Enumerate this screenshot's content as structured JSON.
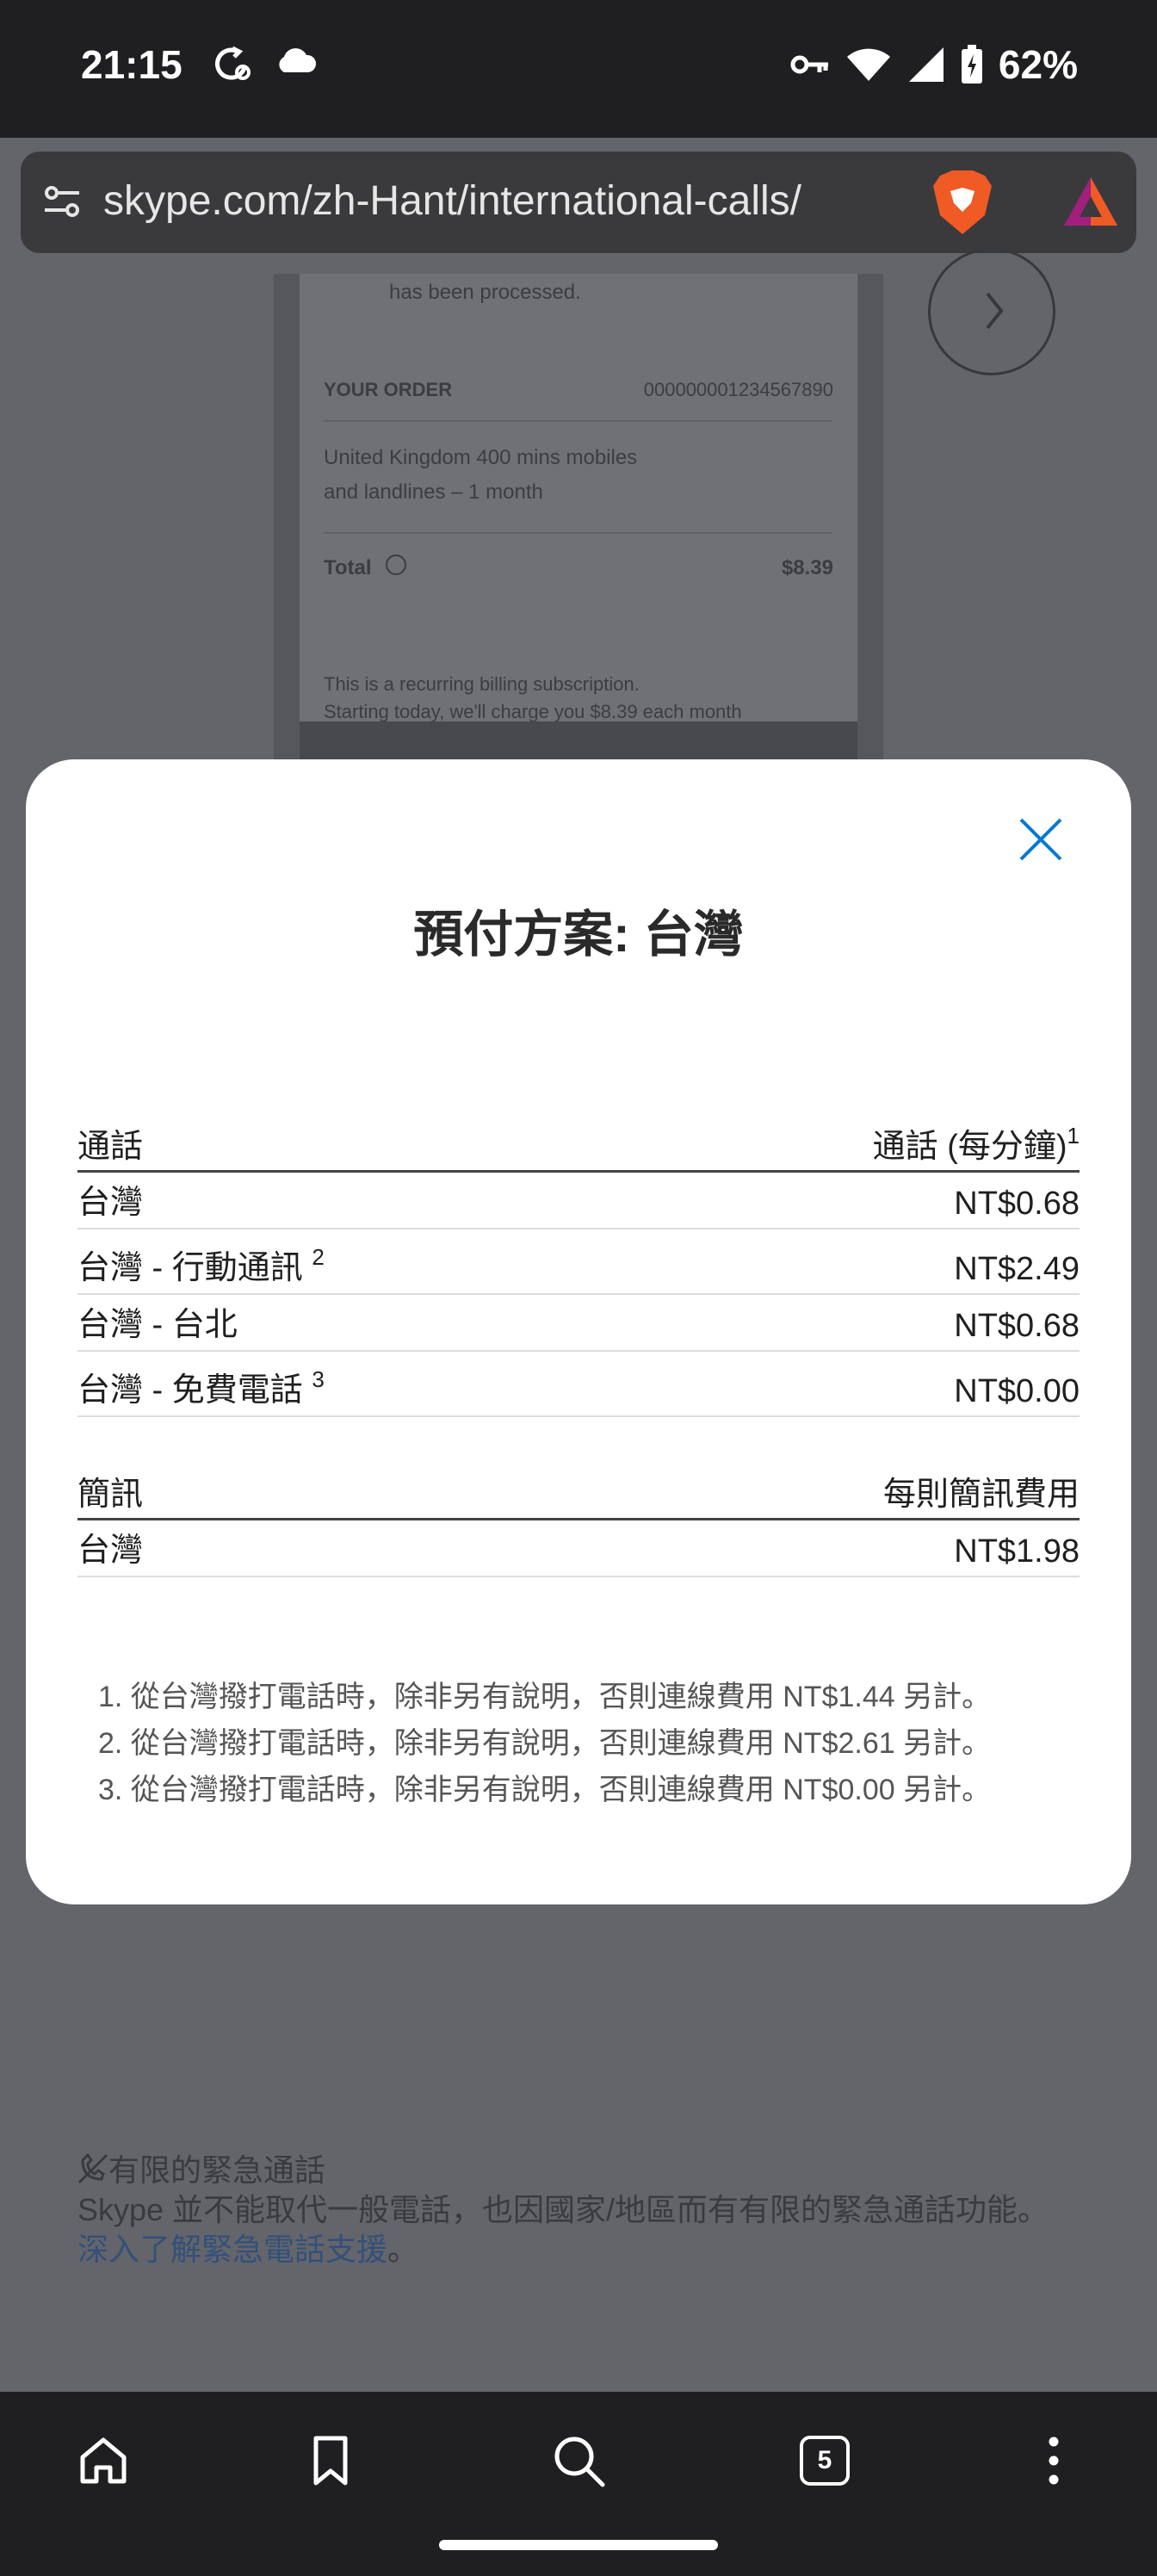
{
  "status_bar": {
    "time": "21:15",
    "battery": "62%",
    "icons": [
      "sync-icon",
      "cloud-icon",
      "vpn-key-icon",
      "wifi-icon",
      "signal-icon",
      "battery-charging-icon"
    ]
  },
  "browser": {
    "url": "skype.com/zh-Hant/international-calls/",
    "tab_count": "5",
    "toolbar_icons": [
      "home-icon",
      "bookmark-icon",
      "search-icon",
      "tabs-icon",
      "more-icon"
    ]
  },
  "background_page": {
    "processed_text": "has been processed.",
    "your_order_label": "YOUR ORDER",
    "order_number": "000000001234567890",
    "plan_line1": "United Kingdom 400 mins mobiles",
    "plan_line2": "and landlines – 1 month",
    "total_label": "Total",
    "total_value": "$8.39",
    "recurring_text": "This is a recurring billing subscription.",
    "charge_text": "Starting today, we'll charge you $8.39 each month",
    "emergency_title": "有限的緊急通話",
    "emergency_body": "Skype 並不能取代一般電話，也因國家/地區而有有限的緊急通話功能。",
    "emergency_link": "深入了解緊急電話支援",
    "emergency_link_suffix": "。"
  },
  "modal": {
    "title": "預付方案: 台灣",
    "calls_table": {
      "header_left": "通話",
      "header_right": "通話 (每分鐘)",
      "header_right_sup": "1",
      "rows": [
        {
          "name": "台灣",
          "sup": "",
          "rate": "NT$0.68"
        },
        {
          "name": "台灣 - 行動通訊 ",
          "sup": "2",
          "rate": "NT$2.49"
        },
        {
          "name": "台灣 - 台北",
          "sup": "",
          "rate": "NT$0.68"
        },
        {
          "name": "台灣 - 免費電話 ",
          "sup": "3",
          "rate": "NT$0.00"
        }
      ]
    },
    "sms_table": {
      "header_left": "簡訊",
      "header_right": "每則簡訊費用",
      "rows": [
        {
          "name": "台灣",
          "rate": "NT$1.98"
        }
      ]
    },
    "footnotes": [
      "1. 從台灣撥打電話時，除非另有說明，否則連線費用 NT$1.44 另計。",
      "2. 從台灣撥打電話時，除非另有說明，否則連線費用 NT$2.61 另計。",
      "3. 從台灣撥打電話時，除非另有說明，否則連線費用 NT$0.00 另計。"
    ]
  },
  "colors": {
    "accent_blue": "#0078d4",
    "overlay": "#63656b",
    "chrome_dark": "#1f1f21"
  }
}
